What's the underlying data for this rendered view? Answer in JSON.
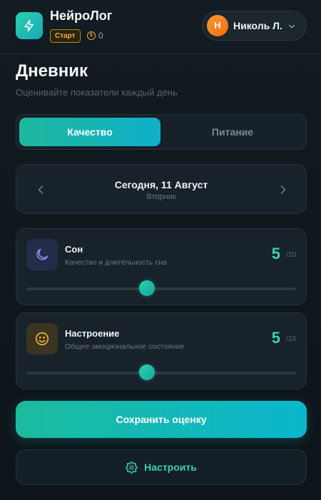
{
  "header": {
    "app_title": "НейроЛог",
    "plan_badge": "Старт",
    "coins": "0",
    "user_initial": "Н",
    "user_name": "Николь Л."
  },
  "page": {
    "title": "Дневник",
    "subtitle": "Оценивайте показатели каждый день"
  },
  "tabs": [
    {
      "label": "Качество",
      "active": true
    },
    {
      "label": "Питание",
      "active": false
    }
  ],
  "date": {
    "main": "Сегодня, 11 Август",
    "weekday": "Вторник"
  },
  "metrics": [
    {
      "title": "Сон",
      "description": "Качество и длительность сна",
      "value": "5",
      "max": "/10",
      "icon": "moon-icon"
    },
    {
      "title": "Настроение",
      "description": "Общее эмоциональное состояние",
      "value": "5",
      "max": "/10",
      "icon": "smile-icon"
    }
  ],
  "actions": {
    "save_label": "Сохранить оценку",
    "settings_label": "Настроить"
  },
  "colors": {
    "accent": "#1fb89e",
    "accent_alt": "#0fb0c9",
    "background": "#0f181d",
    "badge": "#f2b33d"
  }
}
